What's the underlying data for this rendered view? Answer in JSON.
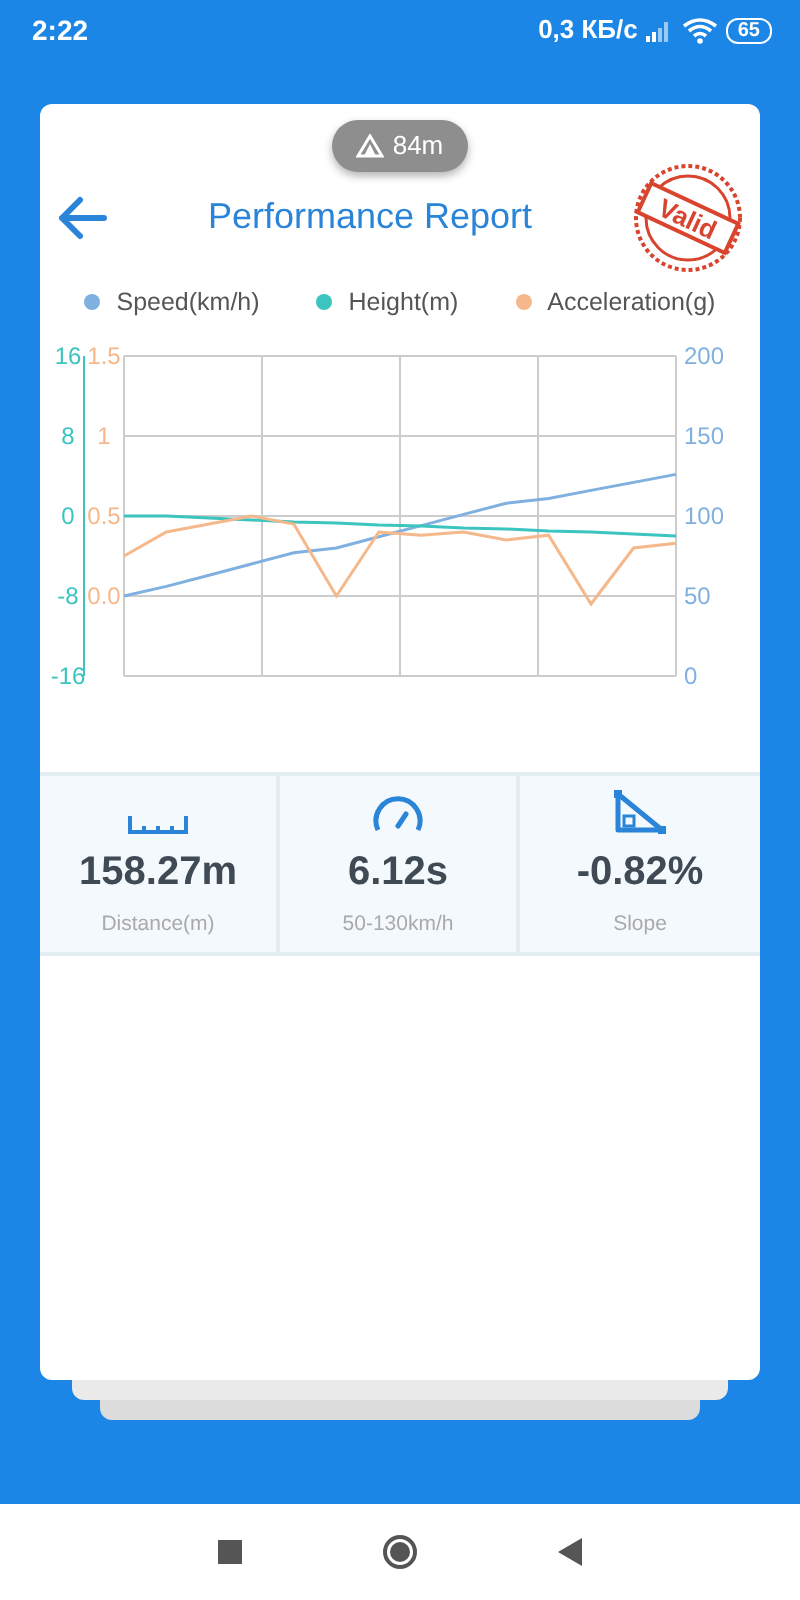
{
  "status_bar": {
    "time": "2:22",
    "network_speed": "0,3 КБ/с",
    "battery": "65"
  },
  "altitude_pill": {
    "text": "84m"
  },
  "header": {
    "title": "Performance Report",
    "stamp": "Valid"
  },
  "chart": {
    "chart_data": {
      "type": "line",
      "grid": true,
      "ylim": [
        0,
        200
      ],
      "yticks": [
        0,
        50,
        100,
        150,
        200
      ],
      "y2lim": [
        -16,
        16
      ],
      "y2ticks": [
        -16,
        -8,
        0,
        8,
        16
      ],
      "y3lim": [
        -0.5,
        1.5
      ],
      "y3ticks": [
        {
          "value": 0,
          "label": "0.0"
        },
        0.5,
        1,
        1.5
      ],
      "series": [
        {
          "name": "Speed(km/h)",
          "color": "#7fb0e0",
          "values": [
            50,
            56,
            63,
            70,
            77,
            80,
            87,
            94,
            101,
            108,
            111,
            116,
            121,
            126
          ]
        },
        {
          "name": "Height(m)",
          "color": "#3cc4c0",
          "axis": "y2",
          "values": [
            0,
            0,
            -0.2,
            -0.4,
            -0.6,
            -0.7,
            -0.9,
            -1,
            -1.2,
            -1.3,
            -1.5,
            -1.6,
            -1.8,
            -2
          ]
        },
        {
          "name": "Acceleration(g)",
          "color": "#f5b88a",
          "axis": "y3",
          "values": [
            0.25,
            0.4,
            0.45,
            0.5,
            0.45,
            0.0,
            0.4,
            0.38,
            0.4,
            0.35,
            0.38,
            -0.05,
            0.3,
            0.33
          ]
        }
      ]
    }
  },
  "stats": [
    {
      "kind": "distance",
      "value": "158.27m",
      "label": "Distance(m)"
    },
    {
      "kind": "time",
      "value": "6.12s",
      "label": "50-130km/h"
    },
    {
      "kind": "slope",
      "value": "-0.82%",
      "label": "Slope"
    }
  ]
}
